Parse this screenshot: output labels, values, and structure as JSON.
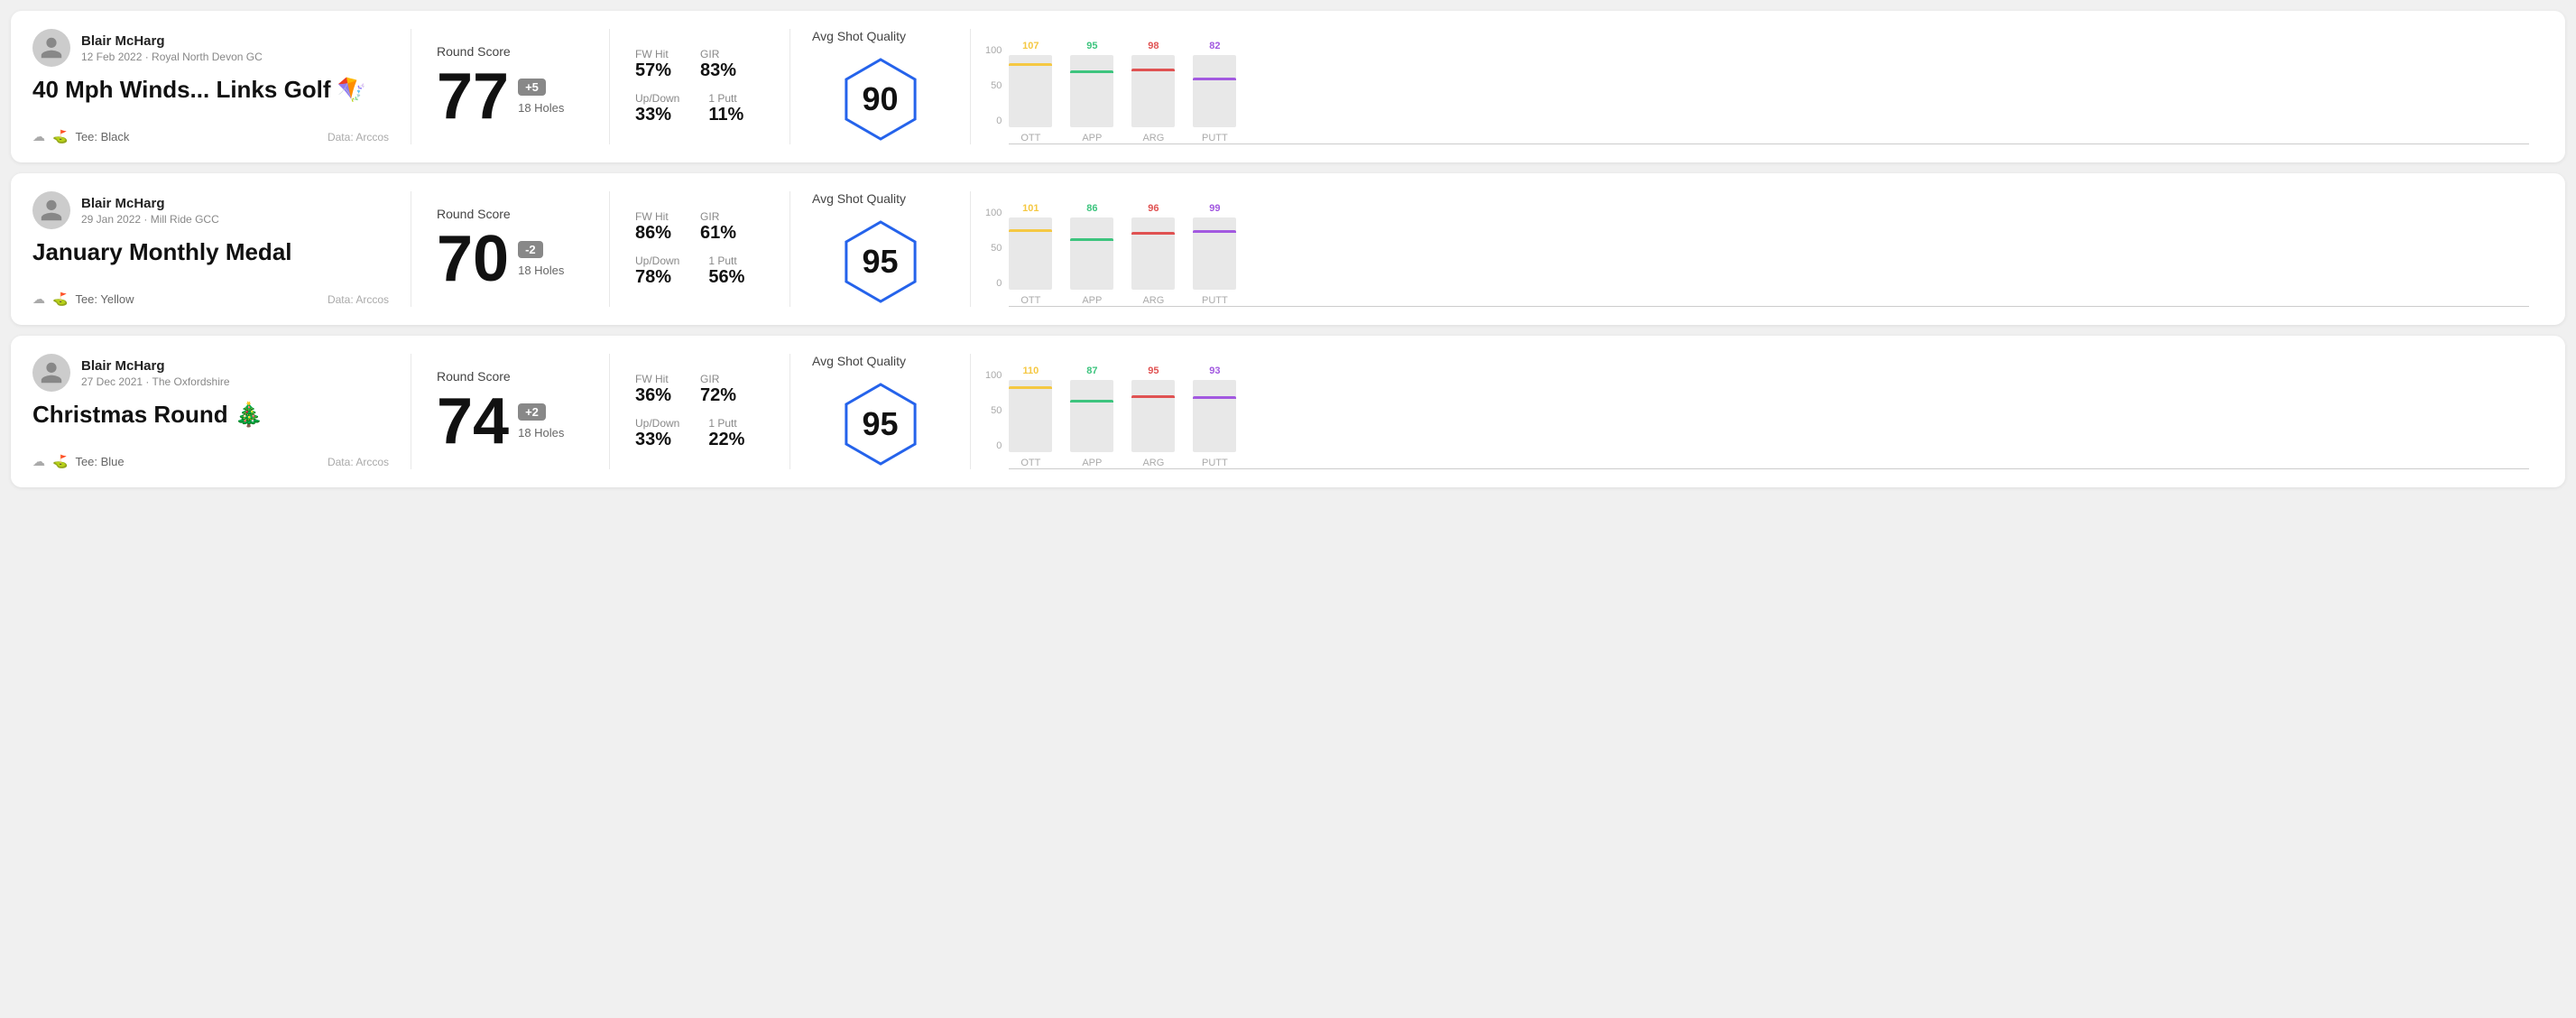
{
  "rounds": [
    {
      "id": "round1",
      "user": {
        "name": "Blair McHarg",
        "meta": "12 Feb 2022 · Royal North Devon GC"
      },
      "title": "40 Mph Winds... Links Golf 🪁",
      "tee": "Black",
      "data_source": "Data: Arccos",
      "score": "77",
      "score_badge": "+5",
      "badge_type": "positive",
      "holes": "18 Holes",
      "fw_hit": "57%",
      "gir": "83%",
      "up_down": "33%",
      "one_putt": "11%",
      "avg_shot_quality": "90",
      "chart": {
        "bars": [
          {
            "label": "OTT",
            "value": 107,
            "color": "#f5c842"
          },
          {
            "label": "APP",
            "value": 95,
            "color": "#3dc47e"
          },
          {
            "label": "ARG",
            "value": 98,
            "color": "#e05252"
          },
          {
            "label": "PUTT",
            "value": 82,
            "color": "#a259e0"
          }
        ]
      }
    },
    {
      "id": "round2",
      "user": {
        "name": "Blair McHarg",
        "meta": "29 Jan 2022 · Mill Ride GCC"
      },
      "title": "January Monthly Medal",
      "tee": "Yellow",
      "data_source": "Data: Arccos",
      "score": "70",
      "score_badge": "-2",
      "badge_type": "negative",
      "holes": "18 Holes",
      "fw_hit": "86%",
      "gir": "61%",
      "up_down": "78%",
      "one_putt": "56%",
      "avg_shot_quality": "95",
      "chart": {
        "bars": [
          {
            "label": "OTT",
            "value": 101,
            "color": "#f5c842"
          },
          {
            "label": "APP",
            "value": 86,
            "color": "#3dc47e"
          },
          {
            "label": "ARG",
            "value": 96,
            "color": "#e05252"
          },
          {
            "label": "PUTT",
            "value": 99,
            "color": "#a259e0"
          }
        ]
      }
    },
    {
      "id": "round3",
      "user": {
        "name": "Blair McHarg",
        "meta": "27 Dec 2021 · The Oxfordshire"
      },
      "title": "Christmas Round 🎄",
      "tee": "Blue",
      "data_source": "Data: Arccos",
      "score": "74",
      "score_badge": "+2",
      "badge_type": "positive",
      "holes": "18 Holes",
      "fw_hit": "36%",
      "gir": "72%",
      "up_down": "33%",
      "one_putt": "22%",
      "avg_shot_quality": "95",
      "chart": {
        "bars": [
          {
            "label": "OTT",
            "value": 110,
            "color": "#f5c842"
          },
          {
            "label": "APP",
            "value": 87,
            "color": "#3dc47e"
          },
          {
            "label": "ARG",
            "value": 95,
            "color": "#e05252"
          },
          {
            "label": "PUTT",
            "value": 93,
            "color": "#a259e0"
          }
        ]
      }
    }
  ],
  "labels": {
    "round_score": "Round Score",
    "avg_shot_quality": "Avg Shot Quality",
    "fw_hit": "FW Hit",
    "gir": "GIR",
    "up_down": "Up/Down",
    "one_putt": "1 Putt",
    "data_arccos": "Data: Arccos",
    "tee": "Tee:",
    "chart_y_100": "100",
    "chart_y_50": "50",
    "chart_y_0": "0"
  }
}
